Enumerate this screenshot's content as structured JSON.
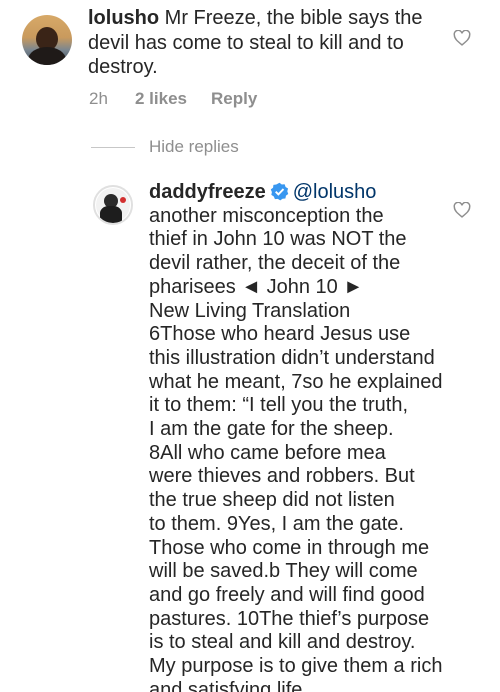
{
  "parent_comment": {
    "username": "lolusho",
    "text": " Mr Freeze,  the bible says the devil has come to steal to kill and to destroy.",
    "time": "2h",
    "likes": "2 likes",
    "reply_label": "Reply"
  },
  "hide_replies_label": "Hide replies",
  "reply_comment": {
    "username": "daddyfreeze",
    "mention": "@lolusho",
    "lines": [
      "another misconception the",
      "thief in John 10 was NOT the",
      "devil rather, the deceit of the",
      "pharisees ◄ John 10 ►",
      "New Living Translation",
      "6Those who heard Jesus use",
      "this illustration didn’t understand",
      "what he meant, 7so he explained",
      "it to them: “I tell you the truth,",
      "I am the gate for the sheep.",
      "8All who came before mea",
      "were thieves and robbers. But",
      "the true sheep did not listen",
      "to them. 9Yes, I am the gate.",
      "Those who come in through me",
      "will be saved.b They will come",
      "and go freely and will find good",
      "pastures. 10The thief’s purpose",
      "is to steal and kill and destroy.",
      "My purpose is to give them a rich",
      "and satisfying life."
    ]
  },
  "colors": {
    "text": "#262626",
    "secondary": "#8e8e8e",
    "verified": "#3897f0",
    "mention": "#003569"
  },
  "icons": {
    "like": "heart-outline-icon",
    "verified": "verified-badge-icon"
  }
}
